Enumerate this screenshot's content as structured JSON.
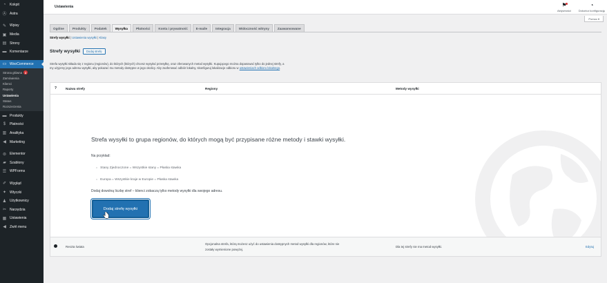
{
  "sidebar": {
    "top_items": [
      {
        "label": "Kokpit",
        "icon": "dashboard-icon",
        "glyph": "◔"
      },
      {
        "label": "Astra",
        "icon": "astra-icon",
        "glyph": "Ⓐ"
      }
    ],
    "items_a": [
      {
        "label": "Wpisy",
        "icon": "pin-icon",
        "glyph": "✎"
      },
      {
        "label": "Media",
        "icon": "media-icon",
        "glyph": "▣"
      },
      {
        "label": "Strony",
        "icon": "pages-icon",
        "glyph": "▤"
      },
      {
        "label": "Komentarze",
        "icon": "comments-icon",
        "glyph": "▬"
      }
    ],
    "woo": {
      "label": "WooCommerce",
      "icon": "woocommerce-icon",
      "glyph": "▭"
    },
    "woo_sub": [
      {
        "label": "Strona główna",
        "badge": "2"
      },
      {
        "label": "Zamówienia"
      },
      {
        "label": "Klienci"
      },
      {
        "label": "Raporty"
      },
      {
        "label": "Ustawienia",
        "current": true
      },
      {
        "label": "Status"
      },
      {
        "label": "Rozszerzenia"
      }
    ],
    "items_b": [
      {
        "label": "Produkty",
        "icon": "products-icon",
        "glyph": "▬"
      },
      {
        "label": "Płatności",
        "icon": "payments-icon",
        "glyph": "$"
      },
      {
        "label": "Analityka",
        "icon": "analytics-icon",
        "glyph": "▥"
      },
      {
        "label": "Marketing",
        "icon": "marketing-icon",
        "glyph": "◀"
      }
    ],
    "items_c": [
      {
        "label": "Elementor",
        "icon": "elementor-icon",
        "glyph": "⊜"
      },
      {
        "label": "Szablony",
        "icon": "templates-icon",
        "glyph": "▰"
      },
      {
        "label": "WPForms",
        "icon": "wpforms-icon",
        "glyph": "☰"
      }
    ],
    "items_d": [
      {
        "label": "Wygląd",
        "icon": "appearance-icon",
        "glyph": "✐"
      },
      {
        "label": "Wtyczki",
        "icon": "plugins-icon",
        "glyph": "✦"
      },
      {
        "label": "Użytkownicy",
        "icon": "users-icon",
        "glyph": "♟"
      },
      {
        "label": "Narzędzia",
        "icon": "tools-icon",
        "glyph": "✂"
      },
      {
        "label": "Ustawienia",
        "icon": "settings-icon",
        "glyph": "▦"
      },
      {
        "label": "Zwiń menu",
        "icon": "collapse-icon",
        "glyph": "◀"
      }
    ]
  },
  "header": {
    "title": "Ustawienia",
    "activity_label": "Aktywności",
    "setup_label": "Dokończ konfigurację",
    "help_label": "Pomoc ▾"
  },
  "tabs": [
    {
      "label": "Ogólne"
    },
    {
      "label": "Produkty"
    },
    {
      "label": "Podatek"
    },
    {
      "label": "Wysyłka",
      "active": true
    },
    {
      "label": "Płatności"
    },
    {
      "label": "Konta i prywatność"
    },
    {
      "label": "E-maile"
    },
    {
      "label": "Integracja"
    },
    {
      "label": "Widoczność witryny"
    },
    {
      "label": "Zaawansowane"
    }
  ],
  "subsub": {
    "current": "Strefy wysyłki",
    "link1": "Ustawienia wysyłki",
    "link2": "Klasy",
    "sep": " | "
  },
  "heading": {
    "title": "Strefy wysyłki",
    "add_button": "Dodaj strefę"
  },
  "description": {
    "text": "Strefa wysyłki składa się z regionu (regionów), do których (których) chcesz wysyłać przesyłkę, oraz oferowanych metod wysyłki. Kupującego można dopasować tylko do jednej strefy, a my użyjemy jego adresu wysyłki, aby pokazać mu metody dostępne w jego okolicy. Aby zaoferować odbiór lokalny, skonfiguruj lokalizacje odbioru w ",
    "link": "ustawieniach odbioru lokalnego",
    "end": "."
  },
  "table": {
    "col_name": "Nazwa strefy",
    "col_regions": "Regiony",
    "col_methods": "Metody wysyłki",
    "blank_title": "Strefa wysyłki to grupa regionów, do których mogą być przypisane różne metody i stawki wysyłki.",
    "example_label": "Na przykład:",
    "examples": [
      "Stany Zjednoczone = Wszystkie stany = Płaska stawka",
      "Europa = Wszystkie kraje w Europie = Płaska stawka"
    ],
    "note": "Dodaj dowolną liczbę stref – klienci zobaczą tylko metody wysyłki dla swojego adresu.",
    "primary_button": "Dodaj strefę wysyłki",
    "rest": {
      "name": "Reszta świata",
      "regions_line1": "Opcjonalna strefa, którą możesz użyć do ustawienia dostępnych metod wysyłki dla regionów, które nie",
      "regions_line2": "zostały wymienione powyżej.",
      "methods": "Dla tej strefy nie ma metod wysyłki.",
      "edit": "Edytuj"
    }
  },
  "colors": {
    "accent": "#2271b1",
    "sidebar": "#1d2327",
    "badge": "#d63638"
  }
}
